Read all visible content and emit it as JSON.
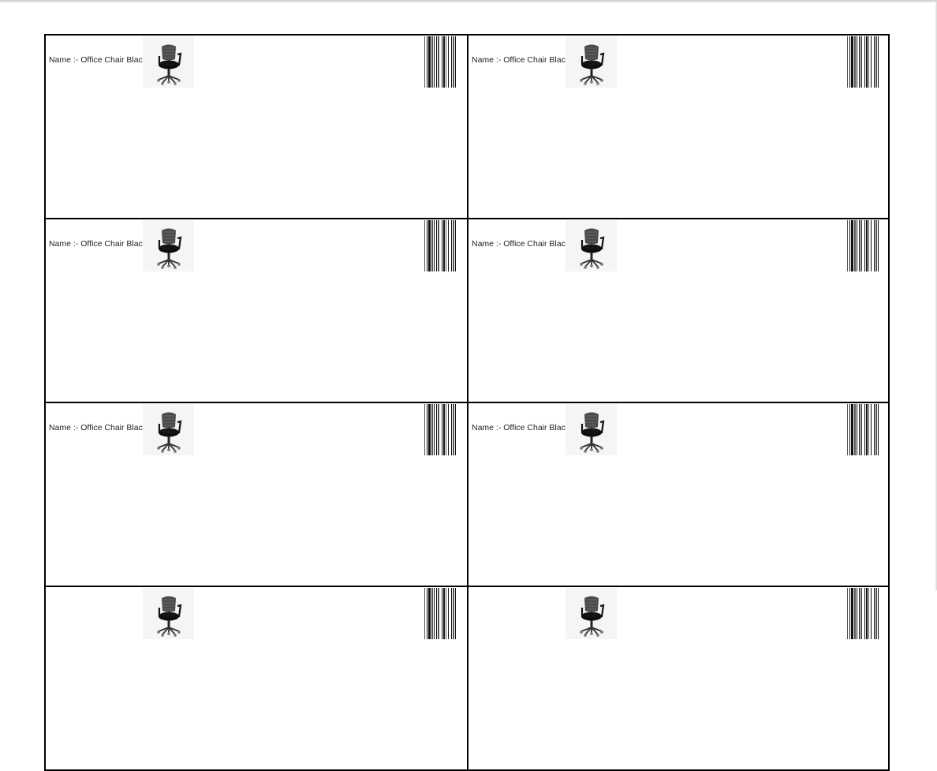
{
  "labels": [
    {
      "name_text": "Name :- Office Chair Black"
    },
    {
      "name_text": "Name :- Office Chair Black"
    },
    {
      "name_text": "Name :- Office Chair Black"
    },
    {
      "name_text": "Name :- Office Chair Black"
    },
    {
      "name_text": "Name :- Office Chair Black"
    },
    {
      "name_text": "Name :- Office Chair Black"
    },
    {
      "name_text": ""
    },
    {
      "name_text": ""
    }
  ],
  "product_photo_icon": "office-chair-icon",
  "barcode_icon": "barcode-icon",
  "colors": {
    "border": "#000000",
    "text": "#222222",
    "photo_background": "#f5f5f5"
  }
}
